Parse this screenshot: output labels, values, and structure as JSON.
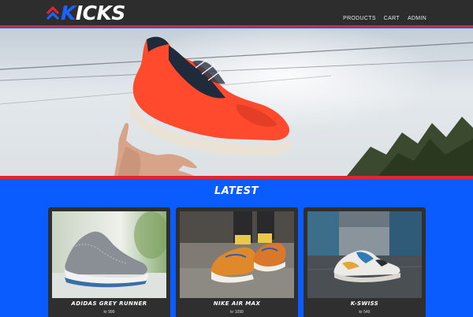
{
  "brand": {
    "name_rest": "ICKS",
    "name_first": "K"
  },
  "nav": [
    "PRODUCTS",
    "CART",
    "ADMIN"
  ],
  "section": {
    "title": "LATEST"
  },
  "products": [
    {
      "name": "ADIDAS GREY RUNNER",
      "price": "kr 999"
    },
    {
      "name": "NIKE AIR MAX",
      "price": "kr 1099"
    },
    {
      "name": "K-SWISS",
      "price": "kr 549"
    }
  ],
  "colors": {
    "accent_red": "#e5232f",
    "brand_blue": "#0b5cff",
    "header_dark": "#2d2d2d",
    "card_dark": "#2f2f2f"
  }
}
